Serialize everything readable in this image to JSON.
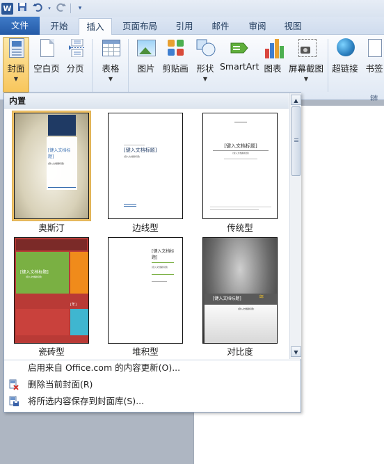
{
  "qat": {
    "app_icon_letter": "W",
    "buttons": [
      "save-icon",
      "undo-icon",
      "redo-icon",
      "customize-icon"
    ]
  },
  "tabs": [
    {
      "label": "文件"
    },
    {
      "label": "开始"
    },
    {
      "label": "插入"
    },
    {
      "label": "页面布局"
    },
    {
      "label": "引用"
    },
    {
      "label": "邮件"
    },
    {
      "label": "审阅"
    },
    {
      "label": "视图"
    }
  ],
  "active_tab": "插入",
  "ribbon": {
    "buttons": [
      {
        "label": "封面",
        "icon": "cover-page-icon",
        "has_dropdown": true
      },
      {
        "label": "空白页",
        "icon": "blank-page-icon"
      },
      {
        "label": "分页",
        "icon": "page-break-icon"
      },
      {
        "label": "表格",
        "icon": "table-icon",
        "has_dropdown": true
      },
      {
        "label": "图片",
        "icon": "picture-icon"
      },
      {
        "label": "剪贴画",
        "icon": "clip-art-icon"
      },
      {
        "label": "形状",
        "icon": "shapes-icon",
        "has_dropdown": true
      },
      {
        "label": "SmartArt",
        "icon": "smartart-icon"
      },
      {
        "label": "图表",
        "icon": "chart-icon"
      },
      {
        "label": "屏幕截图",
        "icon": "screenshot-icon",
        "has_dropdown": true
      },
      {
        "label": "超链接",
        "icon": "hyperlink-icon"
      },
      {
        "label": "书签",
        "icon": "bookmark-icon"
      }
    ],
    "group_label_links": "链接"
  },
  "cover_gallery": {
    "header": "内置",
    "items": [
      {
        "label": "奥斯汀",
        "title_text": "[键入文档标题]",
        "subtitle_text": "[键入文档副标题]"
      },
      {
        "label": "边线型",
        "title_text": "[键入文档标题]",
        "subtitle_text": "[键入文档副标题]"
      },
      {
        "label": "传统型",
        "title_text": "[键入文档标题]",
        "subtitle_text": "[键入文档副标题]"
      },
      {
        "label": "瓷砖型",
        "title_text": "[键入文档标题]",
        "subtitle_text": "[键入文档副标题]",
        "year_text": "[年]"
      },
      {
        "label": "堆积型",
        "title_text": "[键入文档标题]",
        "subtitle_text": "[键入文档副标题]"
      },
      {
        "label": "对比度",
        "title_text": "[键入文档标题]",
        "subtitle_text": "[键入文档副标题]"
      }
    ],
    "menu_items": [
      {
        "label": "启用来自 Office.com 的内容更新(O)...",
        "icon": "update-icon"
      },
      {
        "label": "删除当前封面(R)",
        "icon": "delete-cover-icon"
      },
      {
        "label": "将所选内容保存到封面库(S)...",
        "icon": "save-to-gallery-icon"
      }
    ]
  },
  "colors": {
    "file_tab": "#2b5fab",
    "ribbon_bg": "#dfe8f4",
    "pressed_button": "#f8c65c"
  }
}
